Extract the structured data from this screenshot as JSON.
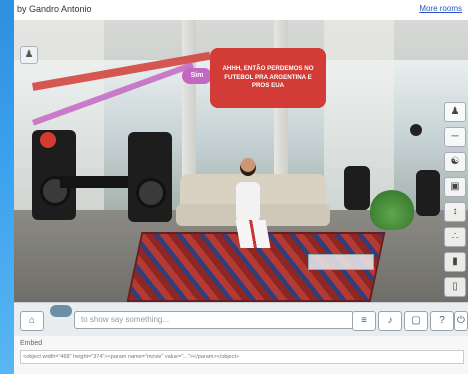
{
  "header": {
    "byline": "by Gandro Antonio",
    "more_link": "More rooms"
  },
  "scene": {
    "bubble_sim": "Sim",
    "speech_text": "AHHH, ENTÃO PERDEMOS NO FUTEBOL PRA ARGENTINA E PROS EUA"
  },
  "chatbar": {
    "placeholder": "to show say something..."
  },
  "embed": {
    "label": "Embed",
    "code": "<object width=\"468\" height=\"374\"><param name=\"movie\" value=\"...\"></param></object>"
  },
  "colors": {
    "speech_bubble": "#d23b36",
    "sim_bubble": "#c466c4",
    "left_strip": "#3aa0ee"
  },
  "icons": {
    "scene_icon": "avatar-icon",
    "tools": [
      "avatar-icon",
      "sit-icon",
      "dance-icon",
      "photo-icon",
      "move-icon",
      "pose-icon",
      "zoom-in-icon",
      "zoom-out-icon"
    ],
    "chat_buttons": [
      "home-icon",
      "emote-icon",
      "volume-icon",
      "fullscreen-icon",
      "help-icon",
      "power-icon"
    ]
  }
}
